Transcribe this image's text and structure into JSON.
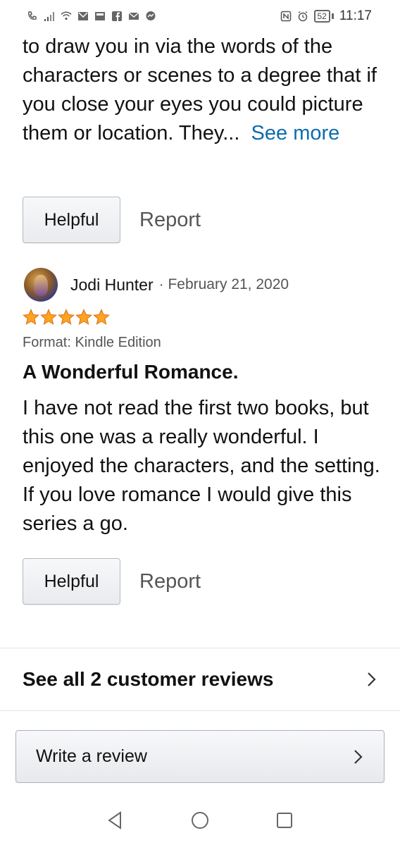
{
  "status_bar": {
    "time": "11:17",
    "battery": "52",
    "icons": [
      "phone-call-icon",
      "signal-icon",
      "wifi-icon",
      "gmail-icon",
      "inbox-icon",
      "facebook-icon",
      "mail-icon",
      "messenger-icon",
      "nfc-icon",
      "alarm-icon",
      "battery-icon"
    ]
  },
  "review1": {
    "text": "to draw you in via the words of the characters or scenes to a degree that if you close your eyes you could picture them or location. They...",
    "see_more": "See more",
    "helpful_label": "Helpful",
    "report_label": "Report"
  },
  "review2": {
    "reviewer_name": "Jodi Hunter",
    "date": "· February 21, 2020",
    "rating": 5,
    "format": "Format: Kindle Edition",
    "title": "A Wonderful Romance.",
    "text": "I have not read the first two books, but this one was a really wonderful. I enjoyed the characters, and the setting. If you love romance I would give this series a go.",
    "helpful_label": "Helpful",
    "report_label": "Report"
  },
  "see_all": {
    "label": "See all 2 customer reviews"
  },
  "write_review": {
    "label": "Write a review"
  },
  "colors": {
    "link": "#0e6cae",
    "star": "#ffa41c",
    "star_outline": "#de7921"
  }
}
